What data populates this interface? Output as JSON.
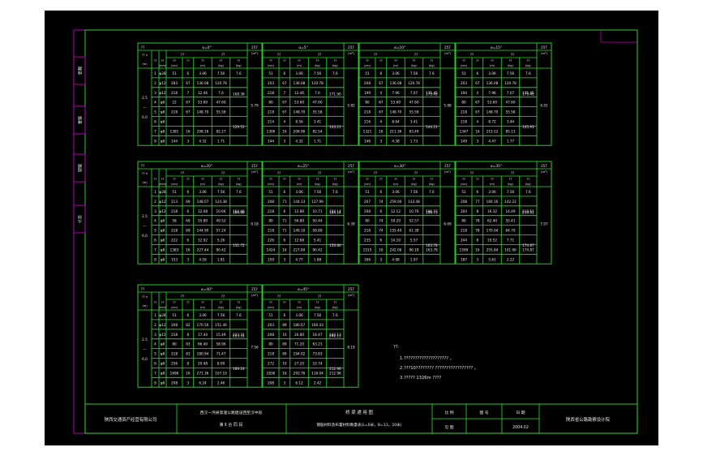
{
  "side_tabs": [
    "隧道",
    "路基",
    "路面",
    "设计"
  ],
  "col_labels": [
    "编号",
    "直径",
    "长度",
    "根数",
    "总长",
    "重量",
    "合计"
  ],
  "misc": {
    "q": "??",
    "count_unit": "?? n",
    "span_unit": "(m)",
    "span": "2.5—6.0",
    "vol_label": "257",
    "vol_unit": "(m³)",
    "unit_mm": "(mm)",
    "unit_cm": "(cm)",
    "unit_m": "(m)",
    "unit_kg": "(kg)"
  },
  "angle_tables": [
    {
      "angle": "α=0°",
      "rows": [
        [
          "1",
          "φ28",
          "51",
          "6",
          "3.06",
          "7.56",
          "7.6"
        ],
        [
          "2",
          "φ12",
          "283",
          "67",
          "136.08",
          "120.78",
          ""
        ],
        [
          "3",
          "φ12",
          "218",
          "7",
          "12.46",
          "7.6",
          ""
        ],
        [
          "4",
          "φ8",
          "22",
          "67",
          "53.60",
          "47.60",
          ""
        ],
        [
          "5",
          "φ8",
          "218",
          "67",
          "148.70",
          "55.58",
          ""
        ],
        [
          "6",
          "φ8",
          "",
          "",
          "",
          "",
          ""
        ],
        [
          "7",
          "φ8",
          "1381",
          "16",
          "208.16",
          "82.27",
          ""
        ],
        [
          "8",
          "φ8",
          "144",
          "3",
          "4.32",
          "1.71",
          ""
        ]
      ],
      "t1": "168.38",
      "t2": "129.51",
      "vol": "5.79"
    },
    {
      "angle": "α=5°",
      "rows": [
        [
          "51",
          "6",
          "3.06",
          "7.56",
          "7.6"
        ],
        [
          "203",
          "67",
          "136.08",
          "120.78",
          ""
        ],
        [
          "218",
          "7",
          "12.46",
          "7.6",
          ""
        ],
        [
          "80",
          "67",
          "53.60",
          "47.60",
          ""
        ],
        [
          "218",
          "67",
          "148.70",
          "55.58",
          ""
        ],
        [
          "214",
          "4",
          "8.56",
          "3.41",
          ""
        ],
        [
          "1306",
          "16",
          "208.96",
          "82.54",
          ""
        ],
        [
          "144",
          "3",
          "4.32",
          "1.71",
          ""
        ]
      ],
      "t1": "171.90",
      "t2": "143.21",
      "vol": "5.82"
    },
    {
      "angle": "α=10°",
      "rows": [
        [
          "51",
          "6",
          "3.06",
          "7.56",
          "7.6"
        ],
        [
          "208",
          "67",
          "136.08",
          "120.78",
          ""
        ],
        [
          "199",
          "4",
          "7.96",
          "7.07",
          "175.45"
        ],
        [
          "80",
          "67",
          "53.60",
          "47.60",
          ""
        ],
        [
          "218",
          "67",
          "148.70",
          "55.58",
          ""
        ],
        [
          "216",
          "4",
          "8.64",
          "3.41",
          ""
        ],
        [
          "1321",
          "16",
          "211.36",
          "83.49",
          ""
        ],
        [
          "146",
          "3",
          "4.38",
          "1.73",
          ""
        ]
      ],
      "t1": "175.45",
      "t2": "144.21",
      "vol": "5.88"
    },
    {
      "angle": "α=15°",
      "rows": [
        [
          "51",
          "6",
          "3.06",
          "7.56",
          "7.6"
        ],
        [
          "203",
          "67",
          "136.08",
          "120.78",
          ""
        ],
        [
          "194",
          "4",
          "7.96",
          "7.07",
          "175.45"
        ],
        [
          "80",
          "67",
          "53.60",
          "47.60",
          ""
        ],
        [
          "218",
          "67",
          "148.70",
          "55.58",
          ""
        ],
        [
          "218",
          "4",
          "8.72",
          "3.44",
          ""
        ],
        [
          "1347",
          "16",
          "215.52",
          "85.13",
          ""
        ],
        [
          "149",
          "3",
          "4.47",
          "1.77",
          ""
        ]
      ],
      "t1": "175.45",
      "t2": "145.93",
      "vol": "6.01"
    },
    {
      "angle": "α=20°",
      "rows": [
        [
          "1",
          "φ28",
          "51",
          "6",
          "3.06",
          "7.56",
          "7.6"
        ],
        [
          "2",
          "φ12",
          "213",
          "69",
          "148.07",
          "124.38",
          ""
        ],
        [
          "3",
          "φ12",
          "218",
          "6",
          "12.08",
          "10.66",
          "164.06"
        ],
        [
          "4",
          "φ8",
          "58",
          "69",
          "55.80",
          "49.52",
          ""
        ],
        [
          "5",
          "φ8",
          "218",
          "69",
          "144.90",
          "57.24",
          ""
        ],
        [
          "6",
          "φ8",
          "222",
          "6",
          "12.92",
          "5.26",
          ""
        ],
        [
          "7",
          "φ8",
          "1383",
          "16",
          "227.44",
          "90.42",
          ""
        ],
        [
          "8",
          "φ8",
          "153",
          "3",
          "4.59",
          "1.81",
          ""
        ]
      ],
      "t1": "164.06",
      "t2": "151.72",
      "vol": "6.18"
    },
    {
      "angle": "α=25°",
      "rows": [
        [
          "51",
          "6",
          "3.06",
          "7.56",
          "7.6"
        ],
        [
          "208",
          "71",
          "144.13",
          "127.99",
          ""
        ],
        [
          "218",
          "6",
          "12.86",
          "10.71",
          "184.14"
        ],
        [
          "80",
          "71",
          "56.80",
          "50.44",
          ""
        ],
        [
          "218",
          "71",
          "149.10",
          "58.89",
          ""
        ],
        [
          "226",
          "6",
          "12.68",
          "5.41",
          ""
        ],
        [
          "1424",
          "16",
          "227.84",
          "90.42",
          ""
        ],
        [
          "159",
          "3",
          "4.77",
          "1.88",
          ""
        ]
      ],
      "t1": "184.14",
      "t2": "156.80",
      "vol": "6.39"
    },
    {
      "angle": "α=30°",
      "rows": [
        [
          "51",
          "6",
          "3.06",
          "7.56",
          "7.6"
        ],
        [
          "207",
          "74",
          "259.00",
          "133.48",
          ""
        ],
        [
          "208",
          "6",
          "12.12",
          "10.76",
          "196.73"
        ],
        [
          "80",
          "74",
          "59.20",
          "52.57",
          ""
        ],
        [
          "218",
          "74",
          "155.40",
          "61.38",
          ""
        ],
        [
          "235",
          "6",
          "14.10",
          "5.57",
          ""
        ],
        [
          "1515",
          "16",
          "242.06",
          "96.18",
          "163.78"
        ],
        [
          "166",
          "3",
          "4.98",
          "1.97",
          ""
        ]
      ],
      "t1": "196.73",
      "t2": "163.78",
      "vol": "6.69"
    },
    {
      "angle": "α=35°",
      "rows": [
        [
          "51",
          "6",
          "3.06",
          "7.56",
          "7.6"
        ],
        [
          "208",
          "77",
          "160.16",
          "142.22",
          ""
        ],
        [
          "204",
          "8",
          "16.32",
          "14.49",
          "210.51"
        ],
        [
          "80",
          "78",
          "62.40",
          "55.41",
          ""
        ],
        [
          "218",
          "78",
          "170.04",
          "64.70",
          ""
        ],
        [
          "244",
          "8",
          "19.52",
          "7.71",
          ""
        ],
        [
          "1599",
          "16",
          "255.84",
          "101.06",
          "174.87"
        ],
        [
          "187",
          "3",
          "5.61",
          "2.22",
          ""
        ]
      ],
      "t1": "210.51",
      "t2": "174.87",
      "vol": "7.07"
    },
    {
      "angle": "α=40°",
      "rows": [
        [
          "1",
          "φ28",
          "51",
          "6",
          "3.06",
          "7.56",
          "7.6"
        ],
        [
          "2",
          "φ12",
          "208",
          "82",
          "170.56",
          "151.46",
          ""
        ],
        [
          "3",
          "φ12",
          "218",
          "8",
          "17.44",
          "15.49",
          "223.31"
        ],
        [
          "4",
          "φ8",
          "80",
          "83",
          "66.40",
          "58.96",
          ""
        ],
        [
          "5",
          "φ8",
          "218",
          "83",
          "180.94",
          "71.47",
          ""
        ],
        [
          "6",
          "φ8",
          "256",
          "8",
          "20.48",
          "8.09",
          ""
        ],
        [
          "7",
          "φ8",
          "1696",
          "16",
          "271.36",
          "107.19",
          ""
        ],
        [
          "8",
          "φ8",
          "208",
          "3",
          "6.24",
          "2.46",
          ""
        ]
      ],
      "t1": "223.31",
      "t2": "189.24",
      "vol": "7.56"
    },
    {
      "angle": "α=45°",
      "rows": [
        [
          "51",
          "6",
          "3.06",
          "7.56",
          "7.6"
        ],
        [
          "203",
          "89",
          "180.67",
          "160.43",
          ""
        ],
        [
          "208",
          "10",
          "20.80",
          "18.47",
          "242.13"
        ],
        [
          "80",
          "89",
          "71.20",
          "63.23",
          ""
        ],
        [
          "218",
          "89",
          "194.02",
          "73.83",
          ""
        ],
        [
          "272",
          "10",
          "27.20",
          "10.74",
          ""
        ],
        [
          "1836",
          "16",
          "293.76",
          "116.04",
          "212.96"
        ],
        [
          "208",
          "3",
          "6.12",
          "2.42",
          ""
        ]
      ],
      "t1": "242.13",
      "t2": "212.96",
      "vol": "8.19"
    }
  ],
  "notes": {
    "title": "??:",
    "lines": [
      "1.????????????????????    。",
      "2.???10????????  ?????????????????    。",
      "3.????? 1326m      ????"
    ]
  },
  "title_block": {
    "company": "陕西交通资产经营有限公司",
    "project_line1": "西汉—沔县高速公路建设西至汉中段",
    "project_line2": "第 Ⅱ 合 同 段",
    "drawing_line1": "桥 梁 通 用 图",
    "drawing_line2": "钢筋材料及布置材料数量表(L=6米，B=13，20米)",
    "scale_label": "比 例",
    "drawing_no_label": "图 号",
    "date_label": "日 期",
    "sheet_label": "见 图",
    "date": "2004.02",
    "institute": "陕西省公路勘察设计院"
  }
}
